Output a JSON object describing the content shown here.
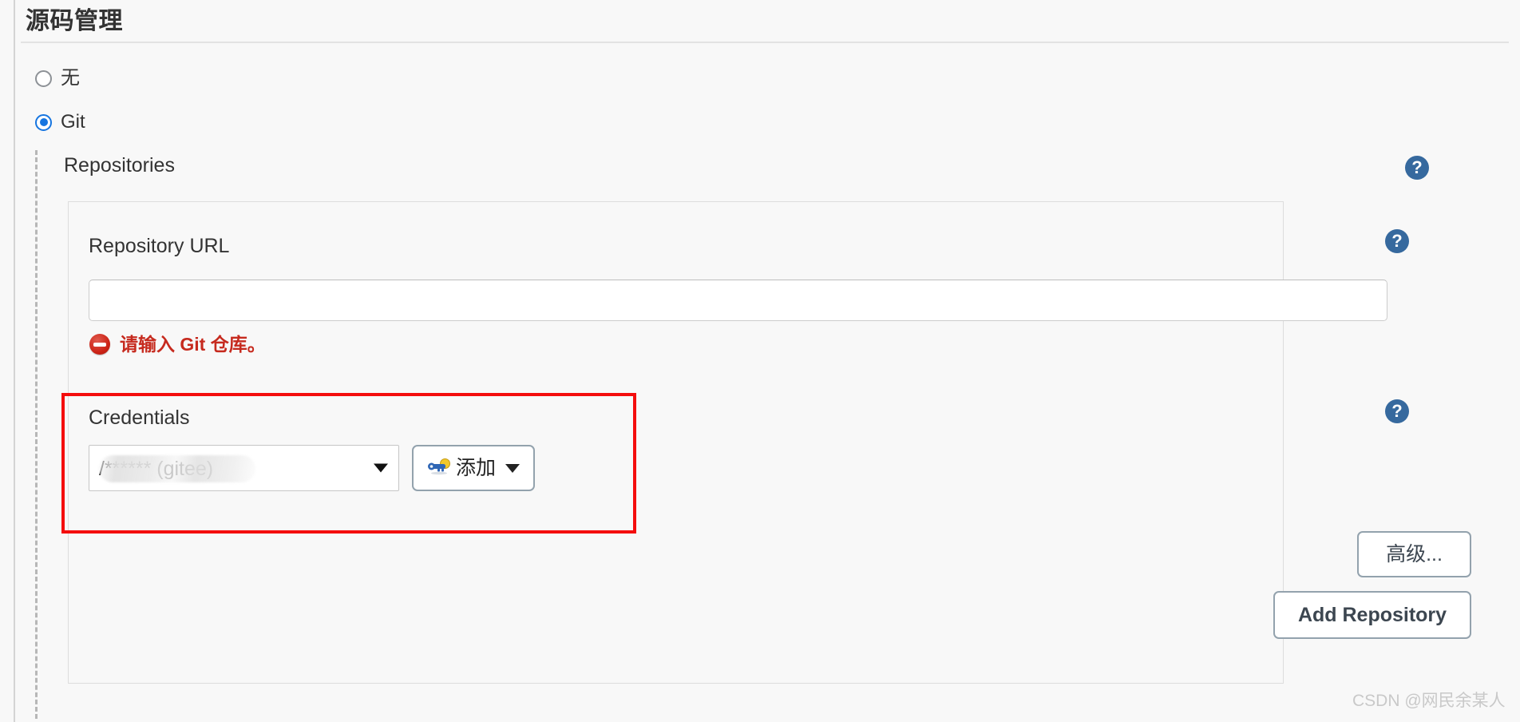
{
  "page": {
    "title": "源码管理",
    "watermark": "CSDN @网民余某人"
  },
  "scm_options": [
    {
      "label": "无",
      "selected": false
    },
    {
      "label": "Git",
      "selected": true
    }
  ],
  "repositories": {
    "heading": "Repositories",
    "help_icon": "?",
    "repo_url": {
      "label": "Repository URL",
      "value": "",
      "placeholder": "",
      "help_icon": "?",
      "error": {
        "icon": "error-circle-minus-icon",
        "text": "请输入 Git 仓库。"
      }
    },
    "credentials": {
      "label": "Credentials",
      "help_icon": "?",
      "selected_value": "/****** (gitee)",
      "add_button": {
        "label": "添加",
        "icon": "key-icon",
        "caret": "chevron-down-icon"
      }
    },
    "advanced_button": "高级...",
    "add_repository_button": "Add Repository"
  },
  "colors": {
    "accent_blue": "#1675e0",
    "help_blue": "#36699e",
    "error_red": "#c62a1e",
    "annotation_red": "#f40d0d",
    "button_border": "#93a2ad"
  }
}
